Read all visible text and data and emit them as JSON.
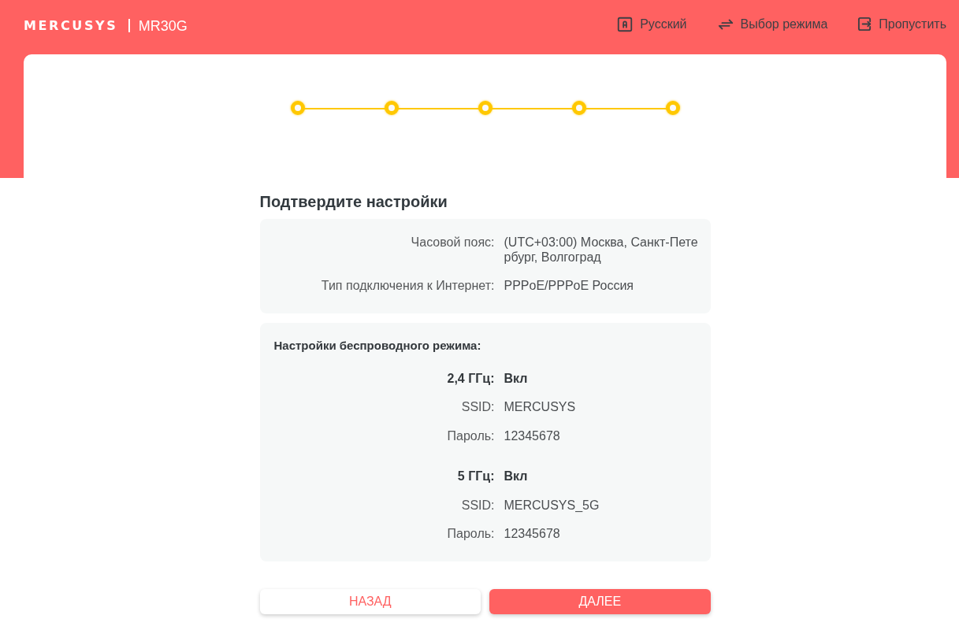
{
  "header": {
    "logo": "MERCUSYS",
    "model": "MR30G",
    "nav": [
      {
        "kind": "language",
        "label": "Русский"
      },
      {
        "kind": "mode",
        "label": "Выбор режима"
      },
      {
        "kind": "skip",
        "label": "Пропустить"
      }
    ]
  },
  "stepper": {
    "steps": [
      {
        "completed": true
      },
      {
        "completed": true
      },
      {
        "completed": true
      },
      {
        "completed": true
      },
      {
        "completed": true
      }
    ]
  },
  "title": "Подтвердите настройки",
  "summary": [
    {
      "label": "Часовой пояс:",
      "value": "(UTC+03:00) Москва, Санкт-Петербург, Волгоград"
    },
    {
      "label": "Тип подключения к Интернет:",
      "value": "PPPoE/PPPoE Россия"
    }
  ],
  "wireless": {
    "heading": "Настройки беспроводного режима:",
    "bands": [
      {
        "label": "2,4 ГГц:",
        "status": "Вкл",
        "rows": [
          {
            "label": "SSID:",
            "value": "MERCUSYS"
          },
          {
            "label": "Пароль:",
            "value": "12345678"
          }
        ]
      },
      {
        "label": "5 ГГц:",
        "status": "Вкл",
        "rows": [
          {
            "label": "SSID:",
            "value": "MERCUSYS_5G"
          },
          {
            "label": "Пароль:",
            "value": "12345678"
          }
        ]
      }
    ]
  },
  "buttons": [
    {
      "kind": "secondary",
      "label": "НАЗАД"
    },
    {
      "kind": "primary",
      "label": "ДАЛЕЕ"
    }
  ]
}
